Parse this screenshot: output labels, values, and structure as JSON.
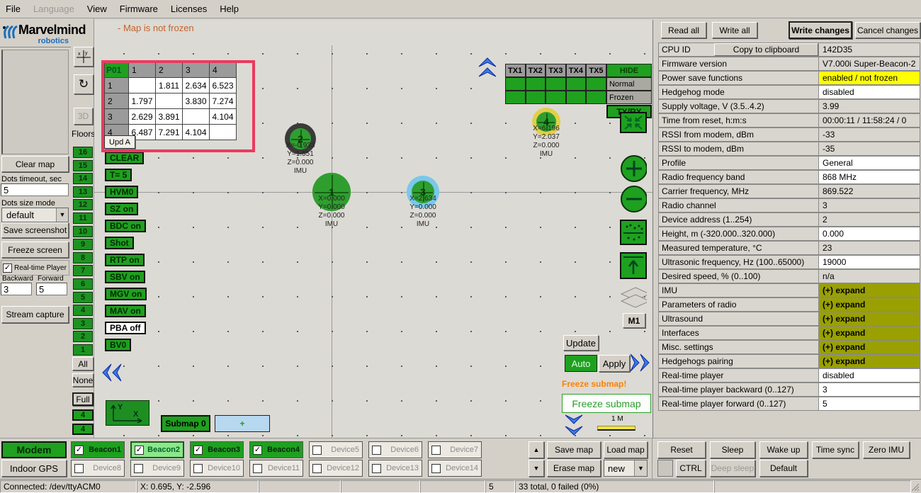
{
  "colors": {
    "accent_green": "#1fa01f",
    "selected_green": "#8ce68c",
    "olive_expand": "#99a000",
    "highlight_yellow": "#ffff00",
    "alert_red_box": "#ea3a5f",
    "warn_orange": "#ff8000",
    "status_orange": "#c4632a",
    "logo_blue": "#1a6fba"
  },
  "menu": {
    "items": [
      {
        "label": "File",
        "disabled": false
      },
      {
        "label": "Language",
        "disabled": true
      },
      {
        "label": "View",
        "disabled": false
      },
      {
        "label": "Firmware",
        "disabled": false
      },
      {
        "label": "Licenses",
        "disabled": false
      },
      {
        "label": "Help",
        "disabled": false
      }
    ]
  },
  "logo": {
    "brand": "Marvelmind",
    "sub": "robotics"
  },
  "sidebar": {
    "three_d": "3D",
    "floors_label": "Floors",
    "floors": [
      "16",
      "15",
      "14",
      "13",
      "12",
      "11",
      "10",
      "9",
      "8",
      "7",
      "6",
      "5",
      "4",
      "3",
      "2",
      "1"
    ],
    "all": "All",
    "none": "None",
    "full": "Full",
    "extra": [
      "4",
      "4"
    ]
  },
  "left_panel": {
    "clear_map": "Clear map",
    "dots_timeout_label": "Dots timeout, sec",
    "dots_timeout_value": "5",
    "dots_size_label": "Dots size mode",
    "dots_size_value": "default",
    "save_screenshot": "Save screenshot",
    "freeze_screen": "Freeze screen",
    "realtime_label": "Real-time Player",
    "backward_label": "Backward",
    "forward_label": "Forward",
    "backward_value": "3",
    "forward_value": "5",
    "stream_capture": "Stream capture",
    "modem": "Modem",
    "indoor_gps": "Indoor GPS"
  },
  "map": {
    "status_text": "- Map is not frozen",
    "upd_a": "Upd A",
    "cmd_buttons": [
      {
        "label": "CLEAR",
        "style": "green"
      },
      {
        "label": "T= 5",
        "style": "green"
      },
      {
        "label": "HVM0",
        "style": "green"
      },
      {
        "label": "SZ on",
        "style": "green"
      },
      {
        "label": "BDC on",
        "style": "green"
      },
      {
        "label": "Shot",
        "style": "green"
      },
      {
        "label": "RTP on",
        "style": "green"
      },
      {
        "label": "SBV on",
        "style": "green"
      },
      {
        "label": "MGV on",
        "style": "green"
      },
      {
        "label": "MAV on",
        "style": "green"
      },
      {
        "label": "PBA off",
        "style": "white"
      },
      {
        "label": "BV0",
        "style": "green"
      }
    ],
    "distance_table": {
      "corner": "P01",
      "cols": [
        "1",
        "2",
        "3",
        "4"
      ],
      "rows": [
        {
          "label": "1",
          "cells": [
            "",
            "1.811",
            "2.634",
            "6.523"
          ]
        },
        {
          "label": "2",
          "cells": [
            "1.797",
            "",
            "3.830",
            "7.274"
          ]
        },
        {
          "label": "3",
          "cells": [
            "2.629",
            "3.891",
            "",
            "4.104"
          ]
        },
        {
          "label": "4",
          "cells": [
            "6.487",
            "7.291",
            "4.104",
            ""
          ]
        }
      ]
    },
    "tx_table": {
      "headers": [
        "TX1",
        "TX2",
        "TX3",
        "TX4",
        "TX5"
      ],
      "hide": "HIDE",
      "normal": "Normal",
      "frozen": "Frozen",
      "txrx": "TX/RX"
    },
    "beacons": [
      {
        "id": "1",
        "ring": "green",
        "lines": [
          "X=0.000",
          "Y=0.000",
          "Z=0.000",
          "IMU"
        ]
      },
      {
        "id": "2",
        "ring": "dark",
        "lines": [
          "X=-0.933",
          "Y=1.551",
          "Z=0.000",
          "IMU"
        ]
      },
      {
        "id": "3",
        "ring": "blue",
        "lines": [
          "X=2.634",
          "Y=0.000",
          "Z=0.000",
          "IMU"
        ]
      },
      {
        "id": "4",
        "ring": "yellow",
        "lines": [
          "X=6.196",
          "Y=2.037",
          "Z=0.000",
          "IMU"
        ]
      }
    ],
    "m1": "M1",
    "update": "Update",
    "auto": "Auto",
    "apply": "Apply",
    "freeze_warning": "Freeze submap!",
    "freeze_button": "Freeze submap",
    "scale_label": "1 M",
    "submap_label": "Submap 0",
    "add_submap": "+"
  },
  "right_panel": {
    "read_all": "Read all",
    "write_all": "Write all",
    "write_changes": "Write changes",
    "cancel_changes": "Cancel changes",
    "copy_button": "Copy to clipboard",
    "rows": [
      {
        "label": "CPU ID",
        "value": "142D35",
        "bg": "gray",
        "button": true
      },
      {
        "label": "Firmware version",
        "value": "V7.000i Super-Beacon-2",
        "bg": "gray"
      },
      {
        "label": "Power save functions",
        "value": "enabled / not frozen",
        "bg": "yellow"
      },
      {
        "label": "Hedgehog mode",
        "value": "disabled",
        "bg": "white"
      },
      {
        "label": "Supply voltage, V (3.5..4.2)",
        "value": "3.99",
        "bg": "gray"
      },
      {
        "label": "Time from reset, h:m:s",
        "value": "00:00:11 / 11:58:24 / 0",
        "bg": "gray"
      },
      {
        "label": "RSSI from modem, dBm",
        "value": "-33",
        "bg": "gray"
      },
      {
        "label": "RSSI to modem, dBm",
        "value": "-35",
        "bg": "gray"
      },
      {
        "label": "Profile",
        "value": "General",
        "bg": "white"
      },
      {
        "label": "Radio frequency band",
        "value": "868 MHz",
        "bg": "white"
      },
      {
        "label": "Carrier frequency, MHz",
        "value": "869.522",
        "bg": "gray"
      },
      {
        "label": "Radio channel",
        "value": "3",
        "bg": "gray"
      },
      {
        "label": "Device address (1..254)",
        "value": "2",
        "bg": "gray"
      },
      {
        "label": "Height, m (-320.000..320.000)",
        "value": "0.000",
        "bg": "white"
      },
      {
        "label": "Measured temperature, °C",
        "value": "23",
        "bg": "gray"
      },
      {
        "label": "Ultrasonic frequency, Hz (100..65000)",
        "value": "19000",
        "bg": "white"
      },
      {
        "label": "Desired speed, % (0..100)",
        "value": "n/a",
        "bg": "gray"
      },
      {
        "label": "IMU",
        "value": "(+) expand",
        "bg": "olive"
      },
      {
        "label": "Parameters of radio",
        "value": "(+) expand",
        "bg": "olive"
      },
      {
        "label": "Ultrasound",
        "value": "(+) expand",
        "bg": "olive"
      },
      {
        "label": "Interfaces",
        "value": "(+) expand",
        "bg": "olive"
      },
      {
        "label": "Misc. settings",
        "value": "(+) expand",
        "bg": "olive"
      },
      {
        "label": "Hedgehogs pairing",
        "value": "(+) expand",
        "bg": "olive"
      },
      {
        "label": "Real-time player",
        "value": "disabled",
        "bg": "white"
      },
      {
        "label": "Real-time player backward (0..127)",
        "value": "3",
        "bg": "white"
      },
      {
        "label": "Real-time player forward (0..127)",
        "value": "5",
        "bg": "white"
      }
    ]
  },
  "devices": {
    "row1": [
      {
        "label": "Beacon1",
        "checked": true,
        "style": "green"
      },
      {
        "label": "Beacon2",
        "checked": true,
        "style": "selected"
      },
      {
        "label": "Beacon3",
        "checked": true,
        "style": "green"
      },
      {
        "label": "Beacon4",
        "checked": true,
        "style": "green"
      },
      {
        "label": "Device5",
        "checked": false,
        "style": "plain"
      },
      {
        "label": "Device6",
        "checked": false,
        "style": "plain"
      },
      {
        "label": "Device7",
        "checked": false,
        "style": "plain"
      }
    ],
    "row2": [
      {
        "label": "Device8",
        "checked": false,
        "style": "plain"
      },
      {
        "label": "Device9",
        "checked": false,
        "style": "plain"
      },
      {
        "label": "Device10",
        "checked": false,
        "style": "plain"
      },
      {
        "label": "Device11",
        "checked": false,
        "style": "plain"
      },
      {
        "label": "Device12",
        "checked": false,
        "style": "plain"
      },
      {
        "label": "Device13",
        "checked": false,
        "style": "plain"
      },
      {
        "label": "Device14",
        "checked": false,
        "style": "plain"
      }
    ]
  },
  "map_file_buttons": {
    "save": "Save map",
    "load": "Load map",
    "erase": "Erase map",
    "new_value": "new"
  },
  "control_buttons": {
    "reset": "Reset",
    "sleep": "Sleep",
    "wake": "Wake up",
    "time_sync": "Time sync",
    "zero_imu": "Zero IMU",
    "ctrl": "CTRL",
    "deep_sleep": "Deep sleep",
    "default": "Default"
  },
  "status_bar": {
    "cells": [
      "Connected: /dev/ttyACM0",
      "X: 0.695, Y: -2.596",
      "",
      "",
      "",
      "5",
      "33 total, 0 failed (0%)",
      ""
    ]
  }
}
